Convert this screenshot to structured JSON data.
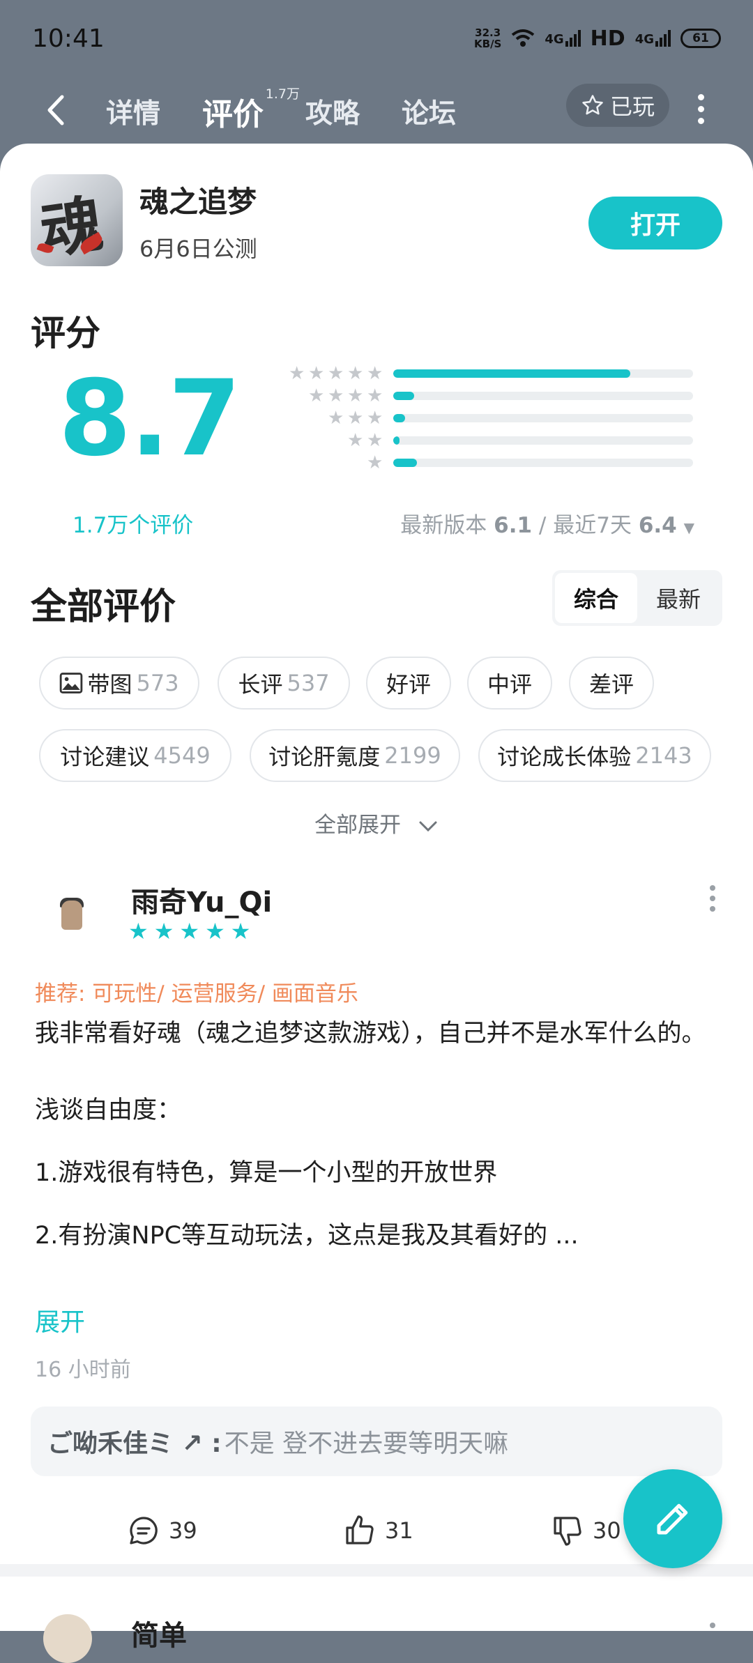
{
  "status": {
    "time": "10:41",
    "speed_value": "32.3",
    "speed_unit": "KB/S",
    "signal1": "4G",
    "hd": "HD",
    "signal2": "4G",
    "battery": "61"
  },
  "nav": {
    "tabs": [
      {
        "label": "详情"
      },
      {
        "label": "评价",
        "badge": "1.7万"
      },
      {
        "label": "攻略"
      },
      {
        "label": "论坛"
      }
    ],
    "played_label": "已玩"
  },
  "game": {
    "name": "魂之追梦",
    "subtitle": "6月6日公测",
    "icon_glyph": "魂",
    "open_label": "打开"
  },
  "rating": {
    "title": "评分",
    "score": "8.7",
    "count_label": "1.7万个评价",
    "distribution": [
      {
        "stars": 5,
        "fraction": 0.79
      },
      {
        "stars": 4,
        "fraction": 0.07
      },
      {
        "stars": 3,
        "fraction": 0.04
      },
      {
        "stars": 2,
        "fraction": 0.02
      },
      {
        "stars": 1,
        "fraction": 0.08
      }
    ],
    "version_prefix": "最新版本",
    "version_score": "6.1",
    "separator": "/",
    "recent_prefix": "最近7天",
    "recent_score": "6.4"
  },
  "reviews_section": {
    "title": "全部评价",
    "sort_options": [
      "综合",
      "最新"
    ],
    "chips": [
      {
        "label": "带图",
        "count": "573"
      },
      {
        "label": "长评",
        "count": "537"
      },
      {
        "label": "好评",
        "count": ""
      },
      {
        "label": "中评",
        "count": ""
      },
      {
        "label": "差评",
        "count": ""
      },
      {
        "label": "讨论建议",
        "count": "4549"
      },
      {
        "label": "讨论肝氪度",
        "count": "2199"
      },
      {
        "label": "讨论成长体验",
        "count": "2143"
      }
    ],
    "expand_all": "全部展开"
  },
  "review": {
    "username": "雨奇Yu_Qi",
    "rating": 5,
    "recommend": "推荐: 可玩性/ 运营服务/ 画面音乐",
    "lines": [
      "我非常看好魂（魂之追梦这款游戏），自己并不是水军什么的。",
      "浅谈自由度：",
      "1.游戏很有特色，算是一个小型的开放世界",
      "2.有扮演NPC等互动玩法，这点是我及其看好的 ..."
    ],
    "expand": "展开",
    "time": "16 小时前",
    "reply_user": "ご呦禾佳ミ ↗ :",
    "reply_text": "不是 登不进去要等明天嘛",
    "comments": "39",
    "likes": "31",
    "dislikes": "30"
  },
  "next_review": {
    "username": "简单"
  },
  "colors": {
    "accent": "#18c3c9",
    "recommend": "#f08a5a",
    "header_bg": "#6d7885"
  }
}
